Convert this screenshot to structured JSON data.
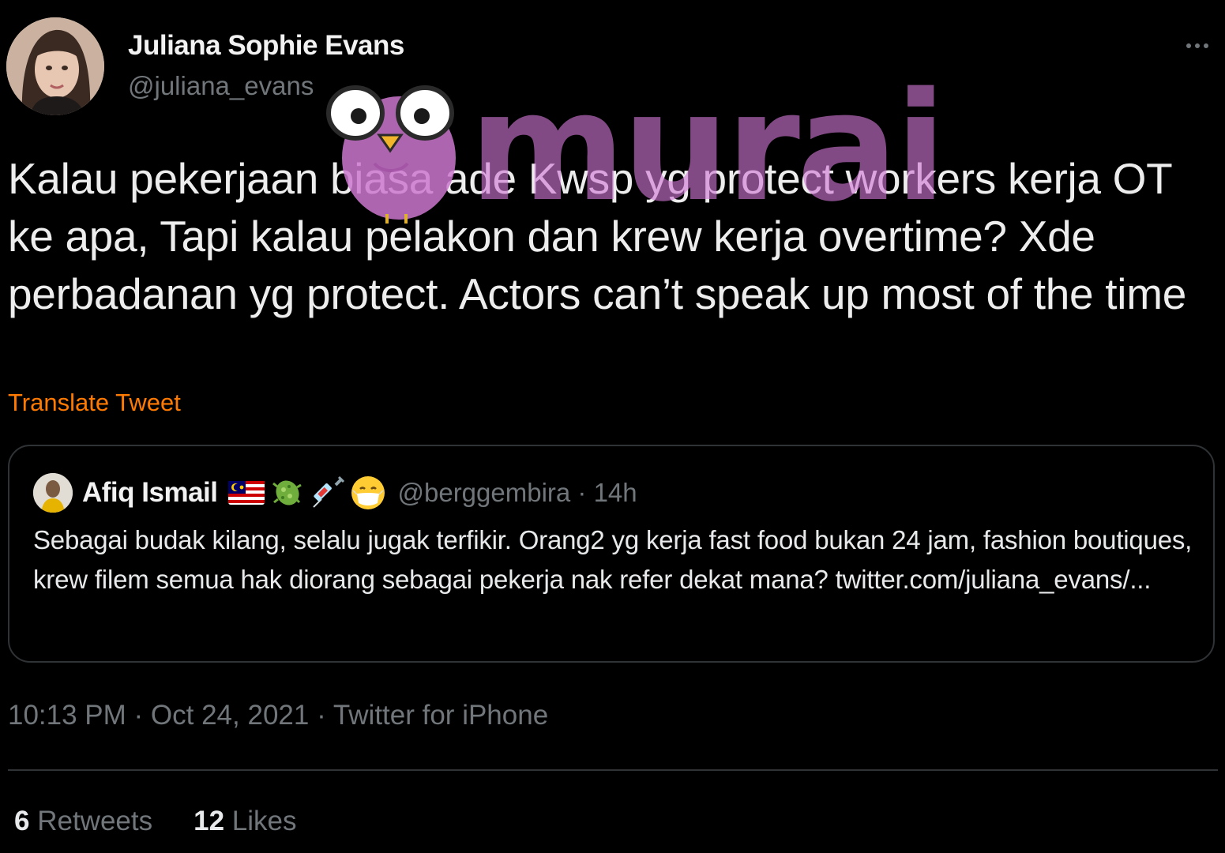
{
  "author": {
    "display_name": "Juliana Sophie Evans",
    "handle": "@juliana_evans"
  },
  "tweet": {
    "text": "Kalau pekerjaan biasa ade Kwsp yg protect workers kerja OT ke apa, Tapi kalau pelakon dan krew kerja overtime? Xde perbadanan yg protect. Actors can’t speak up most of the time",
    "translate_label": "Translate Tweet"
  },
  "quoted": {
    "name": "Afiq Ismail",
    "emojis": [
      "malaysia-flag-icon",
      "microbe-icon",
      "syringe-icon",
      "mask-face-icon"
    ],
    "handle_time": "@berggembira · 14h",
    "text": "Sebagai budak kilang, selalu jugak terfikir. Orang2 yg kerja fast food bukan 24 jam, fashion boutiques, krew filem semua hak diorang sebagai pekerja nak refer dekat mana? twitter.com/juliana_evans/..."
  },
  "meta": {
    "time": "10:13 PM",
    "sep1": " · ",
    "date": "Oct 24, 2021",
    "sep2": " · ",
    "source": "Twitter for iPhone"
  },
  "stats": {
    "retweets_count": "6",
    "retweets_label": "Retweets",
    "likes_count": "12",
    "likes_label": "Likes"
  },
  "watermark": {
    "text": "murai"
  },
  "colors": {
    "background": "#000000",
    "translate": "#ff7a00",
    "secondary": "#71767b",
    "watermark": "#d278d7"
  }
}
